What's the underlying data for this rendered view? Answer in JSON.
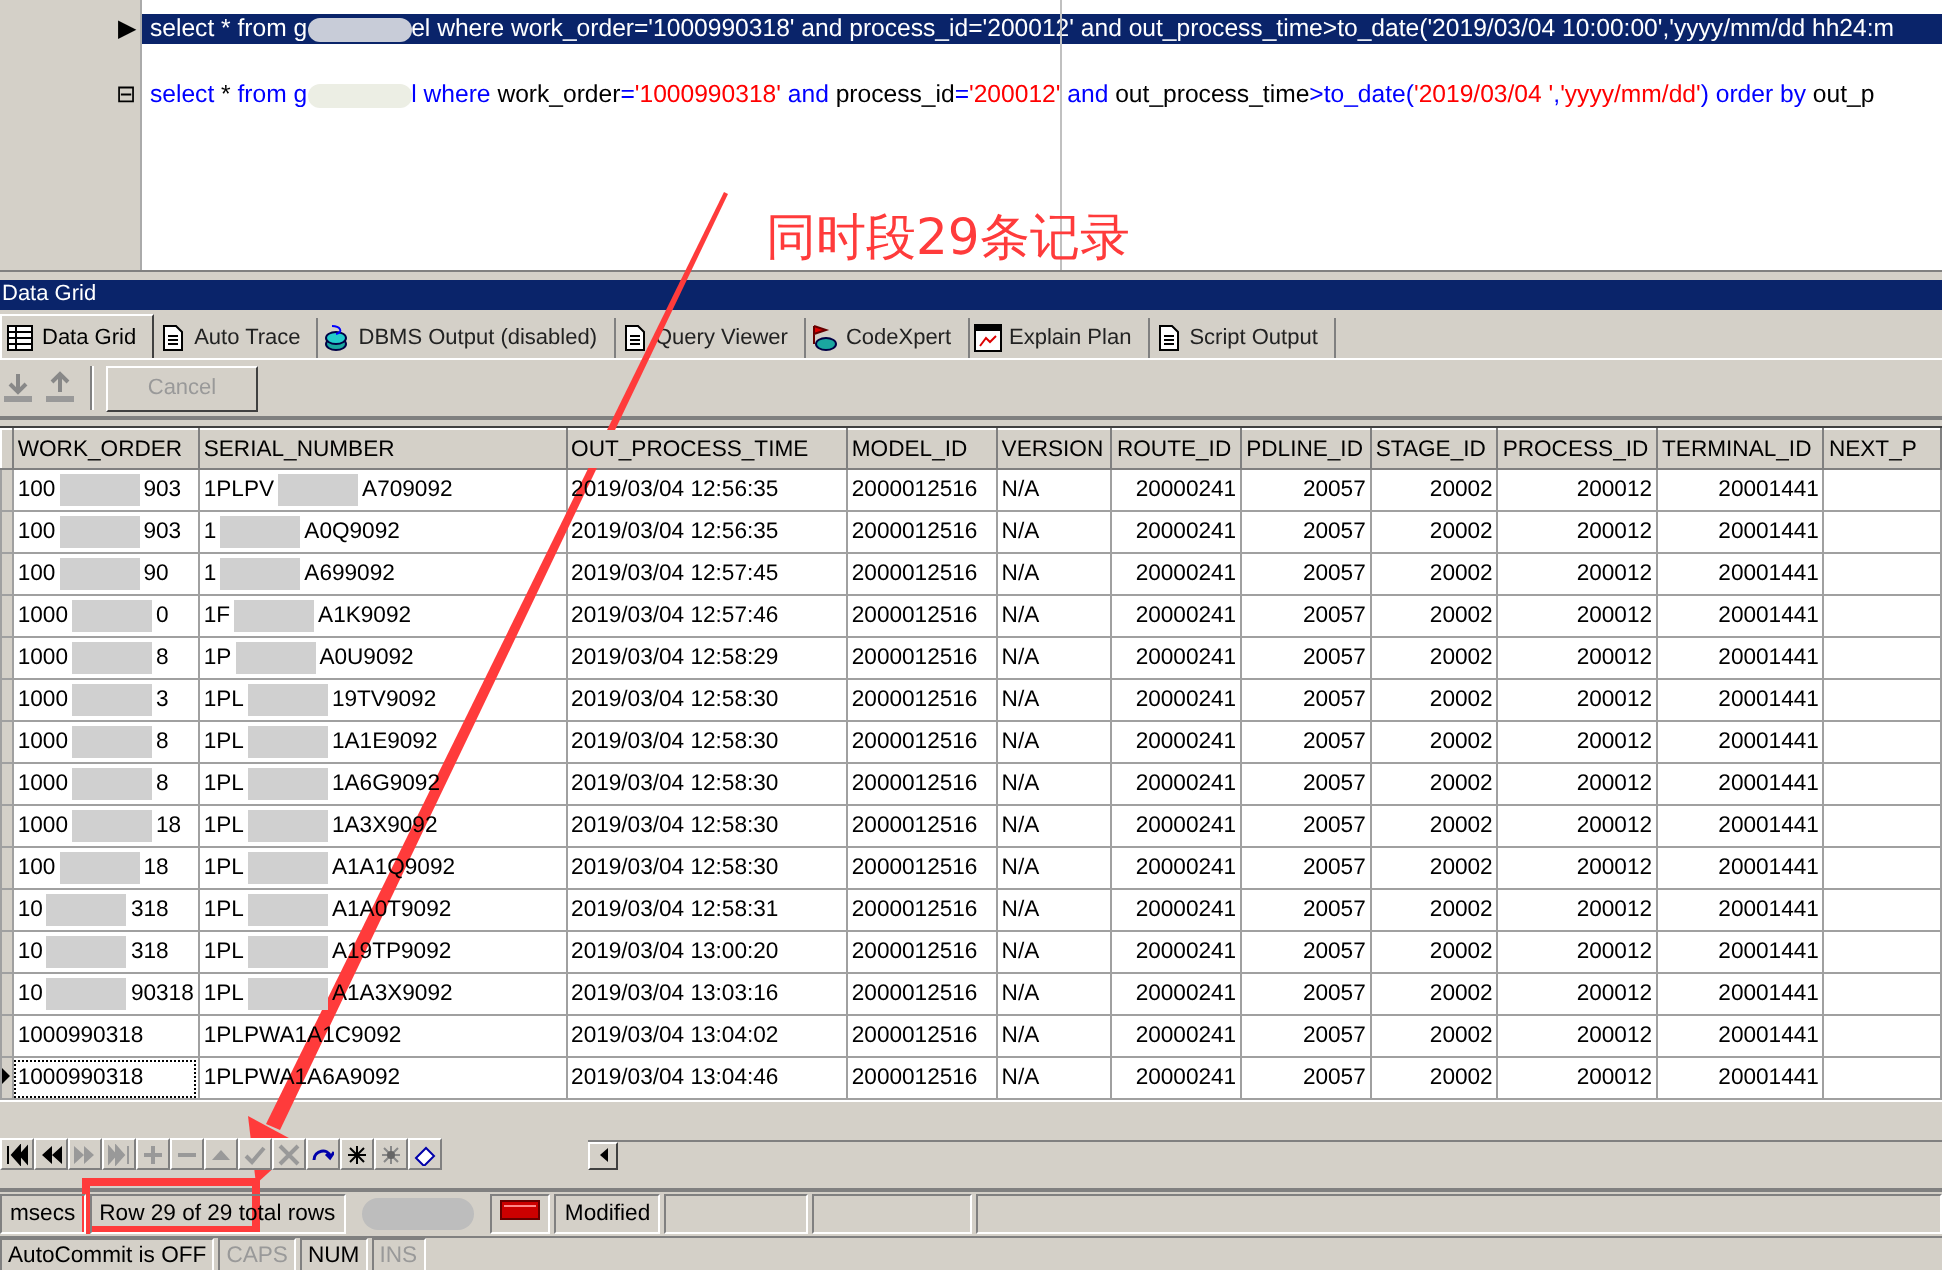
{
  "editor": {
    "lines": [
      {
        "selected": true,
        "marker": "▶",
        "tokens": [
          {
            "kind": "plain",
            "text": "select * from g"
          },
          {
            "kind": "redacted"
          },
          {
            "kind": "plain",
            "text": "el where work_order='1000990318' and process_id='200012' and out_process_time>to_date('2019/03/04 10:00:00','yyyy/mm/dd hh24:m"
          }
        ]
      },
      {
        "selected": false,
        "marker": "⊟",
        "tokens": [
          {
            "kind": "kw",
            "text": "select"
          },
          {
            "kind": "plain",
            "text": " * "
          },
          {
            "kind": "kw",
            "text": "from"
          },
          {
            "kind": "kw",
            "text": " g"
          },
          {
            "kind": "redacted"
          },
          {
            "kind": "kw",
            "text": "l where "
          },
          {
            "kind": "plain",
            "text": "work_order"
          },
          {
            "kind": "kw",
            "text": "="
          },
          {
            "kind": "str",
            "text": "'1000990318'"
          },
          {
            "kind": "kw",
            "text": " and "
          },
          {
            "kind": "plain",
            "text": "process_id"
          },
          {
            "kind": "kw",
            "text": "="
          },
          {
            "kind": "str",
            "text": "'200012'"
          },
          {
            "kind": "kw",
            "text": " and "
          },
          {
            "kind": "plain",
            "text": "out_process_time"
          },
          {
            "kind": "kw",
            "text": ">to_date("
          },
          {
            "kind": "str",
            "text": "'2019/03/04 '"
          },
          {
            "kind": "kw",
            "text": ","
          },
          {
            "kind": "str",
            "text": "'yyyy/mm/dd'"
          },
          {
            "kind": "kw",
            "text": ") order by "
          },
          {
            "kind": "plain",
            "text": "out_p"
          }
        ]
      }
    ]
  },
  "annotation": {
    "text": "同时段29条记录"
  },
  "panel_title": "Data Grid",
  "tabs": [
    {
      "label": "Data Grid",
      "selected": true
    },
    {
      "label": "Auto Trace",
      "selected": false
    },
    {
      "label": "DBMS Output (disabled)",
      "selected": false
    },
    {
      "label": "Query Viewer",
      "selected": false
    },
    {
      "label": "CodeXpert",
      "selected": false
    },
    {
      "label": "Explain Plan",
      "selected": false
    },
    {
      "label": "Script Output",
      "selected": false
    }
  ],
  "toolbar": {
    "cancel": {
      "label": "Cancel",
      "disabled": true
    }
  },
  "table": {
    "columns": [
      "WORK_ORDER",
      "SERIAL_NUMBER",
      "OUT_PROCESS_TIME",
      "MODEL_ID",
      "VERSION",
      "ROUTE_ID",
      "PDLINE_ID",
      "STAGE_ID",
      "PROCESS_ID",
      "TERMINAL_ID",
      "NEXT_P"
    ],
    "rows": [
      {
        "selected": false,
        "cells": [
          [
            "100",
            "903"
          ],
          [
            "1PLPV",
            "A709092"
          ],
          "2019/03/04 12:56:35",
          "2000012516",
          "N/A",
          "20000241",
          "20057",
          "20002",
          "200012",
          "20001441",
          ""
        ]
      },
      {
        "selected": false,
        "cells": [
          [
            "100",
            "903"
          ],
          [
            "1",
            "A0Q9092"
          ],
          "2019/03/04 12:56:35",
          "2000012516",
          "N/A",
          "20000241",
          "20057",
          "20002",
          "200012",
          "20001441",
          ""
        ]
      },
      {
        "selected": false,
        "cells": [
          [
            "100",
            "90"
          ],
          [
            "1",
            "A699092"
          ],
          "2019/03/04 12:57:45",
          "2000012516",
          "N/A",
          "20000241",
          "20057",
          "20002",
          "200012",
          "20001441",
          ""
        ]
      },
      {
        "selected": false,
        "cells": [
          [
            "1000",
            "0"
          ],
          [
            "1F",
            "A1K9092"
          ],
          "2019/03/04 12:57:46",
          "2000012516",
          "N/A",
          "20000241",
          "20057",
          "20002",
          "200012",
          "20001441",
          ""
        ]
      },
      {
        "selected": false,
        "cells": [
          [
            "1000",
            "8"
          ],
          [
            "1P",
            "A0U9092"
          ],
          "2019/03/04 12:58:29",
          "2000012516",
          "N/A",
          "20000241",
          "20057",
          "20002",
          "200012",
          "20001441",
          ""
        ]
      },
      {
        "selected": false,
        "cells": [
          [
            "1000",
            "3"
          ],
          [
            "1PL",
            "19TV9092"
          ],
          "2019/03/04 12:58:30",
          "2000012516",
          "N/A",
          "20000241",
          "20057",
          "20002",
          "200012",
          "20001441",
          ""
        ]
      },
      {
        "selected": false,
        "cells": [
          [
            "1000",
            "8"
          ],
          [
            "1PL",
            "1A1E9092"
          ],
          "2019/03/04 12:58:30",
          "2000012516",
          "N/A",
          "20000241",
          "20057",
          "20002",
          "200012",
          "20001441",
          ""
        ]
      },
      {
        "selected": false,
        "cells": [
          [
            "1000",
            "8"
          ],
          [
            "1PL",
            "1A6G9092"
          ],
          "2019/03/04 12:58:30",
          "2000012516",
          "N/A",
          "20000241",
          "20057",
          "20002",
          "200012",
          "20001441",
          ""
        ]
      },
      {
        "selected": false,
        "cells": [
          [
            "1000",
            "18"
          ],
          [
            "1PL",
            "1A3X9092"
          ],
          "2019/03/04 12:58:30",
          "2000012516",
          "N/A",
          "20000241",
          "20057",
          "20002",
          "200012",
          "20001441",
          ""
        ]
      },
      {
        "selected": false,
        "cells": [
          [
            "100",
            "18"
          ],
          [
            "1PL",
            "A1A1Q9092"
          ],
          "2019/03/04 12:58:30",
          "2000012516",
          "N/A",
          "20000241",
          "20057",
          "20002",
          "200012",
          "20001441",
          ""
        ]
      },
      {
        "selected": false,
        "cells": [
          [
            "10",
            "318"
          ],
          [
            "1PL",
            "A1A0T9092"
          ],
          "2019/03/04 12:58:31",
          "2000012516",
          "N/A",
          "20000241",
          "20057",
          "20002",
          "200012",
          "20001441",
          ""
        ]
      },
      {
        "selected": false,
        "cells": [
          [
            "10",
            "318"
          ],
          [
            "1PL",
            "A19TP9092"
          ],
          "2019/03/04 13:00:20",
          "2000012516",
          "N/A",
          "20000241",
          "20057",
          "20002",
          "200012",
          "20001441",
          ""
        ]
      },
      {
        "selected": false,
        "cells": [
          [
            "10",
            "90318"
          ],
          [
            "1PL",
            "A1A3X9092"
          ],
          "2019/03/04 13:03:16",
          "2000012516",
          "N/A",
          "20000241",
          "20057",
          "20002",
          "200012",
          "20001441",
          ""
        ]
      },
      {
        "selected": false,
        "cells": [
          "1000990318",
          "1PLPWA1A1C9092",
          "2019/03/04 13:04:02",
          "2000012516",
          "N/A",
          "20000241",
          "20057",
          "20002",
          "200012",
          "20001441",
          ""
        ]
      },
      {
        "selected": true,
        "cells": [
          "1000990318",
          "1PLPWA1A6A9092",
          "2019/03/04 13:04:46",
          "2000012516",
          "N/A",
          "20000241",
          "20057",
          "20002",
          "200012",
          "20001441",
          ""
        ]
      }
    ]
  },
  "status_bar": {
    "timing": "msecs",
    "row_info": "Row 29 of 29 total rows",
    "state": "Modified"
  },
  "bottom_bar": [
    {
      "label": "AutoCommit is OFF",
      "disabled": false
    },
    {
      "label": "CAPS",
      "disabled": true
    },
    {
      "label": "NUM",
      "disabled": false
    },
    {
      "label": "INS",
      "disabled": true
    }
  ]
}
